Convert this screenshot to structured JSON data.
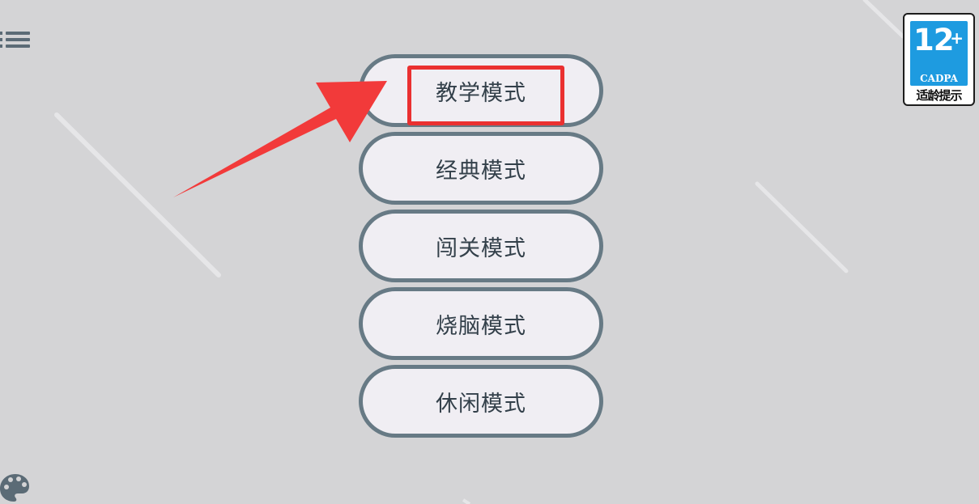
{
  "modes": [
    {
      "label": "教学模式"
    },
    {
      "label": "经典模式"
    },
    {
      "label": "闯关模式"
    },
    {
      "label": "烧脑模式"
    },
    {
      "label": "休闲模式"
    }
  ],
  "age_rating": {
    "age": "12",
    "plus": "+",
    "org": "CADPA",
    "hint": "适龄提示"
  },
  "icons": {
    "menu": "hamburger-menu-icon",
    "palette": "palette-icon",
    "pointer": "red-arrow-annotation"
  },
  "colors": {
    "background": "#d4d4d6",
    "button_fill": "#f0eef3",
    "button_border": "#677a85",
    "button_text": "#33404a",
    "annotation_red": "#ea3030",
    "badge_blue": "#1e9be0"
  }
}
